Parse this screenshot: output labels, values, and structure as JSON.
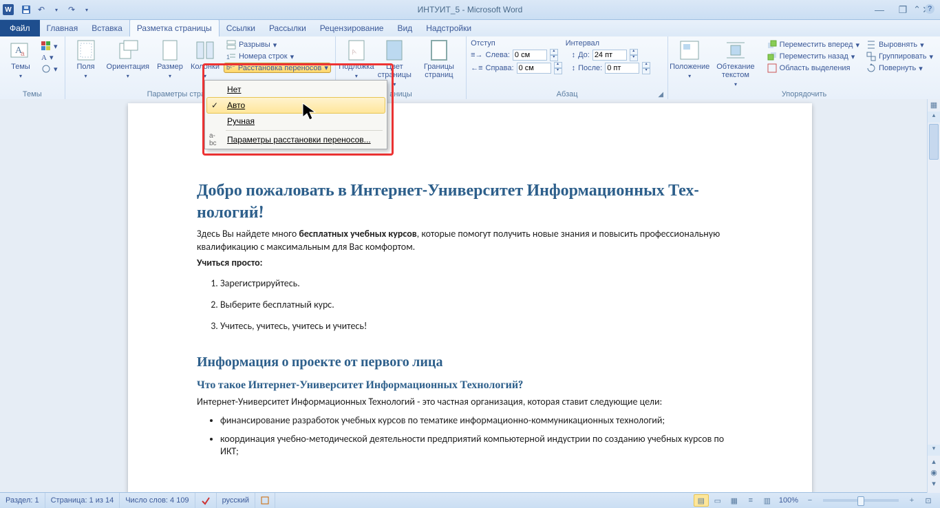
{
  "title": "ИНТУИТ_5 - Microsoft Word",
  "tabs": {
    "file": "Файл",
    "items": [
      "Главная",
      "Вставка",
      "Разметка страницы",
      "Ссылки",
      "Рассылки",
      "Рецензирование",
      "Вид",
      "Надстройки"
    ],
    "activeIndex": 2
  },
  "ribbon": {
    "themes": {
      "label": "Темы",
      "btn": "Темы"
    },
    "pageSetup": {
      "label": "Параметры стра",
      "fields": "Поля",
      "orientation": "Ориентация",
      "size": "Размер",
      "columns": "Колонки",
      "breaks": "Разрывы",
      "lineNumbers": "Номера строк",
      "hyphenation": "Расстановка переносов"
    },
    "pageBg": {
      "watermark": "Подложка",
      "color": "Цвет страницы",
      "borders": "Границы страниц",
      "label": "аницы"
    },
    "paragraph": {
      "indentLabel": "Отступ",
      "spacingLabel": "Интервал",
      "left": "Слева:",
      "right": "Справа:",
      "before": "До:",
      "after": "После:",
      "leftVal": "0 см",
      "rightVal": "0 см",
      "beforeVal": "24 пт",
      "afterVal": "0 пт",
      "label": "Абзац"
    },
    "arrange": {
      "position": "Положение",
      "wrap": "Обтекание текстом",
      "bringFwd": "Переместить вперед",
      "sendBack": "Переместить назад",
      "selection": "Область выделения",
      "align": "Выровнять",
      "group": "Группировать",
      "rotate": "Повернуть",
      "label": "Упорядочить"
    }
  },
  "hyphMenu": {
    "none": "Нет",
    "auto": "Авто",
    "manual": "Ручная",
    "options": "Параметры расстановки переносов..."
  },
  "doc": {
    "h1": "Добро пожаловать в Интернет-Университет Информационных Тех­нологий!",
    "p1a": "Здесь Вы найдете много ",
    "p1b": "бесплатных учебных курсов",
    "p1c": ", которые помогут получить новые знания и повысить профессиональную квалификацию с максимальным для Вас комфортом.",
    "p2": "Учиться просто:",
    "li1": "Зарегистрируйтесь.",
    "li2": "Выберите бесплатный курс.",
    "li3": "Учитесь, учитесь, учитесь и учитесь!",
    "h2": "Информация о проекте от первого лица",
    "h3": "Что такое Интернет-Университет Информационных Технологий?",
    "p3": "Интернет-Университет Информационных Технологий - это частная организация, которая ставит следующие цели:",
    "b1": "финансирование разработок учебных курсов по тематике информационно-коммуникационных технологий;",
    "b2": "координация учебно-методической деятельности предприятий компьютерной индустрии по созданию учебных курсов по ИКТ;"
  },
  "status": {
    "section": "Раздел: 1",
    "page": "Страница: 1 из 14",
    "words": "Число слов: 4 109",
    "lang": "русский",
    "zoom": "100%"
  }
}
